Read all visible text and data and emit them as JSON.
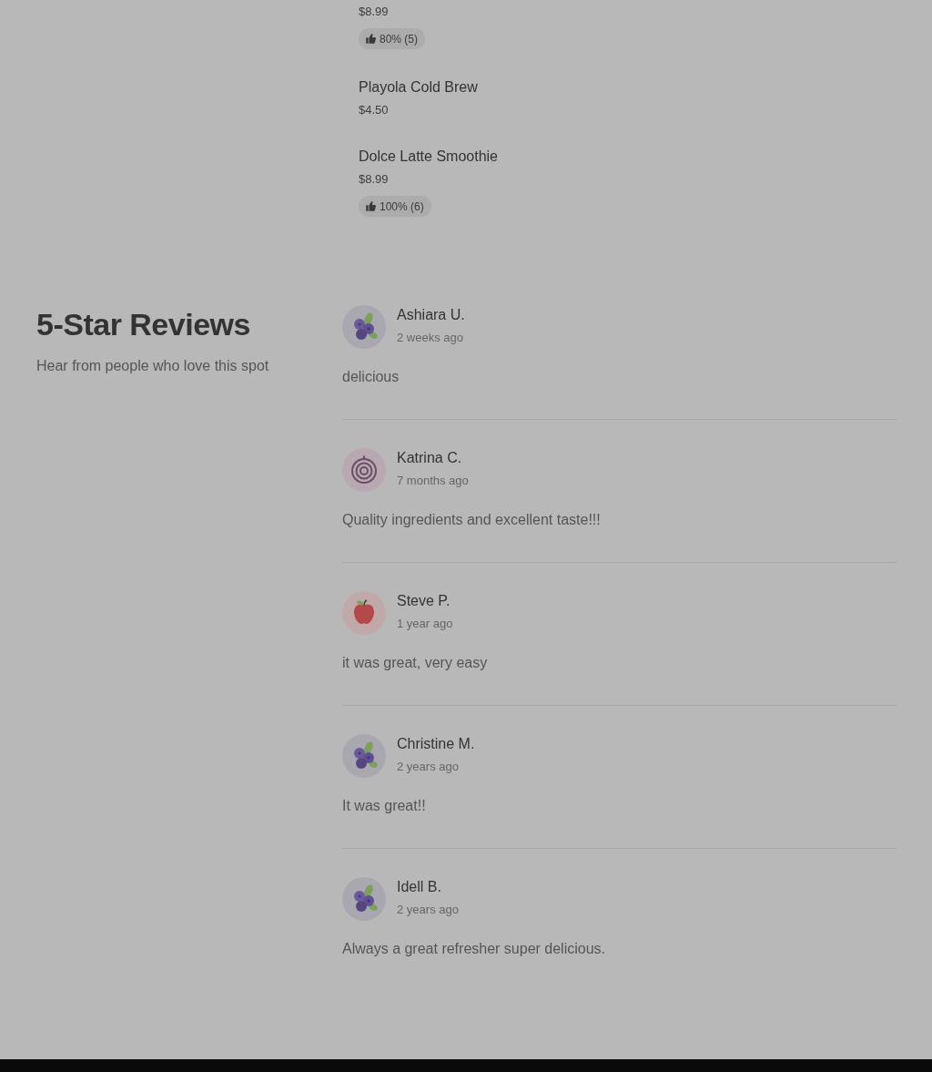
{
  "menu_items": [
    {
      "price": "$8.99",
      "rating": "80% (5)"
    },
    {
      "name": "Playola Cold Brew",
      "price": "$4.50"
    },
    {
      "name": "Dolce Latte Smoothie",
      "price": "$8.99",
      "rating": "100% (6)"
    }
  ],
  "reviews_section": {
    "title": "5-Star Reviews",
    "subtitle": "Hear from people who love this spot",
    "reviews": [
      {
        "kind": "berry",
        "name": "Ashiara U.",
        "time": "2 weeks ago",
        "text": "delicious"
      },
      {
        "kind": "ring",
        "name": "Katrina C.",
        "time": "7 months ago",
        "text": "Quality ingredients and excellent taste!!!"
      },
      {
        "kind": "apple",
        "name": "Steve P.",
        "time": "1 year ago",
        "text": "it was great, very easy"
      },
      {
        "kind": "berry",
        "name": "Christine M.",
        "time": "2 years ago",
        "text": "It was great!!"
      },
      {
        "kind": "berry",
        "name": "Idell B.",
        "time": "2 years ago",
        "text": "Always a great refresher super delicious."
      }
    ]
  }
}
